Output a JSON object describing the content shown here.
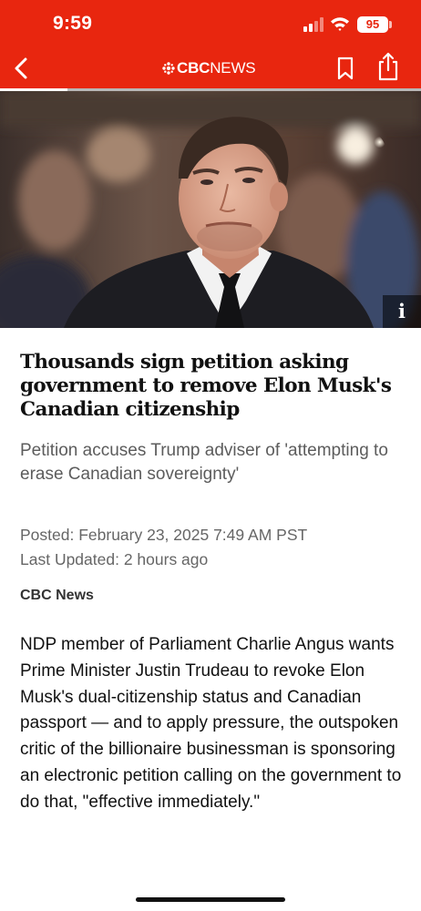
{
  "status_bar": {
    "time": "9:59",
    "battery_level": "95",
    "signal_bars_active": 2,
    "signal_bars_total": 4
  },
  "nav": {
    "back_icon": "chevron-left-icon",
    "logo_text_bold": "CBC",
    "logo_text_light": "NEWS",
    "bookmark_icon": "bookmark-icon",
    "share_icon": "share-icon",
    "reading_progress": 0.16
  },
  "hero": {
    "info_label": "i"
  },
  "article": {
    "headline": "Thousands sign petition asking government to remove Elon Musk's Canadian citizenship",
    "deck": "Petition accuses Trump adviser of 'attempting to erase Canadian sovereignty'",
    "posted": "Posted: February 23, 2025 7:49 AM PST",
    "updated": "Last Updated: 2 hours ago",
    "byline": "CBC News",
    "body": "NDP member of Parliament Charlie Angus wants Prime Minister Justin Trudeau to revoke Elon Musk's dual-citizenship status and Canadian passport — and to apply pressure, the outspoken critic of the billionaire businessman is sponsoring an electronic petition calling on the government to do that, \"effective immediately.\""
  },
  "colors": {
    "brand_red": "#e8260f",
    "text_primary": "#111111",
    "text_secondary": "#5c5c5c"
  }
}
